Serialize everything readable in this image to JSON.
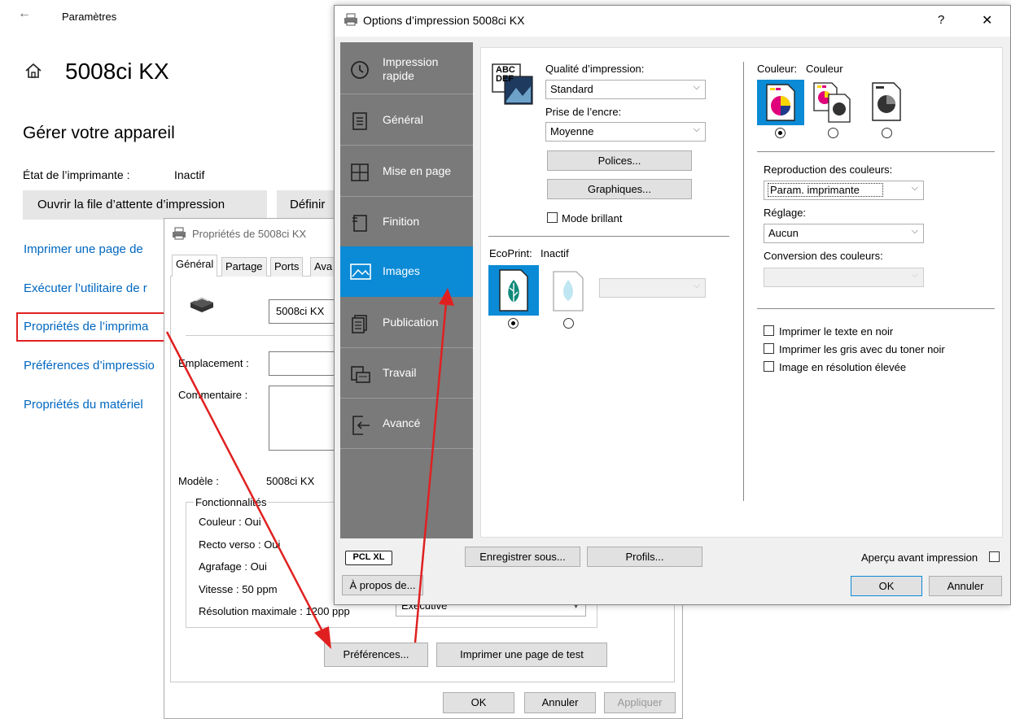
{
  "settings": {
    "back_label": "←",
    "title": "Paramètres",
    "device_name": "5008ci KX",
    "section_title": "Gérer votre appareil",
    "status_label": "État de l’imprimante :",
    "status_value": "Inactif",
    "open_queue_label": "Ouvrir la file d’attente d’impression",
    "define_default_label": "Définir",
    "links": [
      "Imprimer une page de",
      "Exécuter l’utilitaire de r",
      "Propriétés de l’imprima",
      "Préférences d’impressio",
      "Propriétés du matériel"
    ]
  },
  "props": {
    "title": "Propriétés de 5008ci KX",
    "tabs": [
      "Général",
      "Partage",
      "Ports",
      "Ava"
    ],
    "printer_name": "5008ci KX",
    "location_label": "Emplacement :",
    "comment_label": "Commentaire :",
    "model_label": "Modèle :",
    "model_value": "5008ci KX",
    "features_title": "Fonctionnalités",
    "features": [
      "Couleur : Oui",
      "Recto verso : Oui",
      "Agrafage : Oui",
      "Vitesse : 50 ppm",
      "Résolution maximale : 1200 ppp"
    ],
    "paper_value": "Executive",
    "preferences_label": "Préférences...",
    "test_page_label": "Imprimer une page de test",
    "ok_label": "OK",
    "cancel_label": "Annuler",
    "apply_label": "Appliquer"
  },
  "options": {
    "title": "Options d’impression 5008ci KX",
    "help_label": "?",
    "close_label": "✕",
    "nav": [
      {
        "label": "Impression",
        "label2": "rapide",
        "icon": "clock-icon"
      },
      {
        "label": "Général",
        "icon": "document-icon"
      },
      {
        "label": "Mise en page",
        "icon": "layout-icon"
      },
      {
        "label": "Finition",
        "icon": "finishing-icon"
      },
      {
        "label": "Images",
        "icon": "image-icon"
      },
      {
        "label": "Publication",
        "icon": "publication-icon"
      },
      {
        "label": "Travail",
        "icon": "job-icon"
      },
      {
        "label": "Avancé",
        "icon": "advanced-icon"
      }
    ],
    "quality_label": "Qualité d’impression:",
    "quality_value": "Standard",
    "ink_label": "Prise de l’encre:",
    "ink_value": "Moyenne",
    "fonts_label": "Polices...",
    "graphics_label": "Graphiques...",
    "glossy_label": "Mode brillant",
    "ecoprint_label": "EcoPrint:",
    "ecoprint_value": "Inactif",
    "color_label": "Couleur:",
    "color_value": "Couleur",
    "color_repro_label": "Reproduction des couleurs:",
    "color_repro_value": "Param. imprimante",
    "adjust_label": "Réglage:",
    "adjust_value": "Aucun",
    "conversion_label": "Conversion des couleurs:",
    "text_black_label": "Imprimer le texte en noir",
    "gray_black_label": "Imprimer les gris avec du toner noir",
    "high_res_label": "Image en résolution élevée",
    "pclxl_label": "PCL XL",
    "save_as_label": "Enregistrer sous...",
    "profiles_label": "Profils...",
    "preview_label": "Aperçu avant impression",
    "about_label": "À propos de...",
    "ok_label": "OK",
    "cancel_label": "Annuler",
    "abc_line1": "ABC",
    "abc_line2": "DEF"
  },
  "colors": {
    "accent": "#0b8ad6",
    "nav_bg": "#7a7a7a",
    "link": "#0067c0",
    "arrow": "#e02020"
  }
}
